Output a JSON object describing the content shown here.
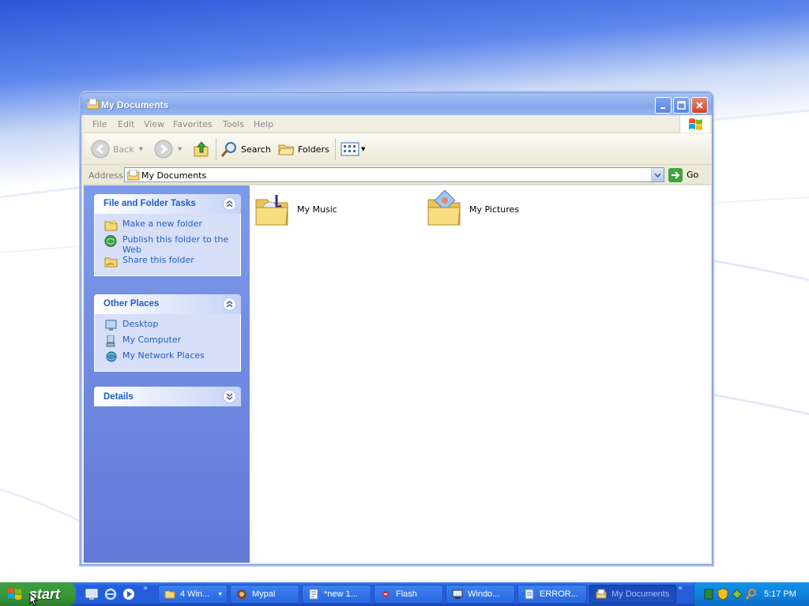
{
  "window": {
    "title": "My Documents",
    "icon": "my-documents-folder-icon",
    "controls": [
      "minimize-icon",
      "maximize-icon",
      "close-icon"
    ]
  },
  "menubar": {
    "items": [
      "File",
      "Edit",
      "View",
      "Favorites",
      "Tools",
      "Help"
    ]
  },
  "toolbar": {
    "back_label": "Back",
    "search_label": "Search",
    "folders_label": "Folders"
  },
  "address": {
    "label": "Address",
    "value": "My Documents",
    "go_label": "Go"
  },
  "taskpane": {
    "file_tasks": {
      "title": "File and Folder Tasks",
      "links": [
        {
          "label": "Make a new folder",
          "icon": "new-folder-icon"
        },
        {
          "label": "Publish this folder to the Web",
          "icon": "publish-web-icon"
        },
        {
          "label": "Share this folder",
          "icon": "share-folder-icon"
        }
      ]
    },
    "other_places": {
      "title": "Other Places",
      "links": [
        {
          "label": "Desktop",
          "icon": "desktop-icon"
        },
        {
          "label": "My Computer",
          "icon": "my-computer-icon"
        },
        {
          "label": "My Network Places",
          "icon": "network-places-icon"
        }
      ]
    },
    "details": {
      "title": "Details"
    }
  },
  "content": {
    "folders": [
      {
        "label": "My Music",
        "icon": "my-music-folder-icon"
      },
      {
        "label": "My Pictures",
        "icon": "my-pictures-folder-icon"
      }
    ]
  },
  "taskbar": {
    "start_label": "start",
    "tasks": [
      {
        "label": "4 Win...",
        "icon": "folder-group-icon"
      },
      {
        "label": "Mypal",
        "icon": "mypal-browser-icon"
      },
      {
        "label": "*new 1...",
        "icon": "notepad-icon"
      },
      {
        "label": "Flash",
        "icon": "flash-icon"
      },
      {
        "label": "Windo...",
        "icon": "window-app-icon"
      },
      {
        "label": "ERROR...",
        "icon": "document-icon"
      },
      {
        "label": "My Documents",
        "icon": "my-documents-folder-icon"
      }
    ],
    "clock": "5:17 PM"
  },
  "colors": {
    "titlebar": "#8fb1ee",
    "taskpane_link": "#215dc6",
    "start_green": "#3a9a3a",
    "taskbar_blue": "#245edb"
  }
}
